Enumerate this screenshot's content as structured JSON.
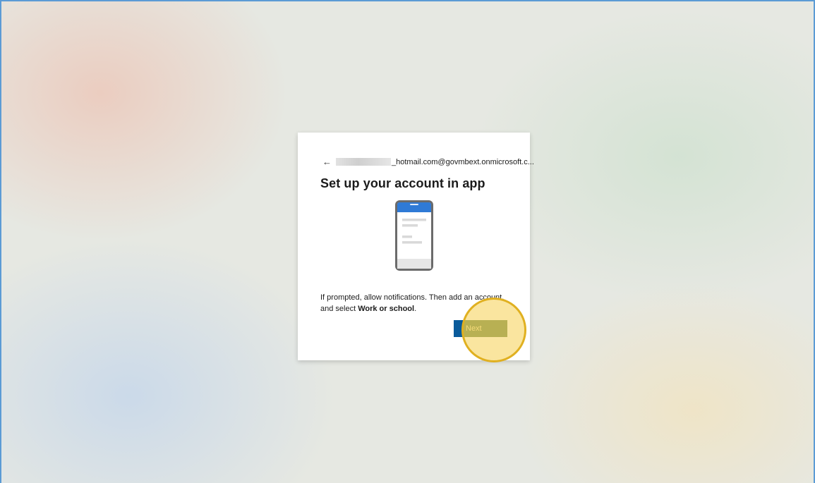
{
  "account": {
    "back_icon": "left-arrow-icon",
    "back_symbol": "←",
    "email_suffix": "_hotmail.com@govmbext.onmicrosoft.c..."
  },
  "dialog": {
    "title": "Set up your account in app",
    "message_prefix": "If prompted, allow notifications. Then add an account, and select ",
    "message_bold": "Work or school",
    "message_suffix": ".",
    "next_label": "Next"
  },
  "colors": {
    "accent": "#0a5b9b",
    "phone_header": "#2f7ad6",
    "highlight": "#e0b020"
  },
  "illustration": {
    "icon": "phone-app-icon"
  }
}
